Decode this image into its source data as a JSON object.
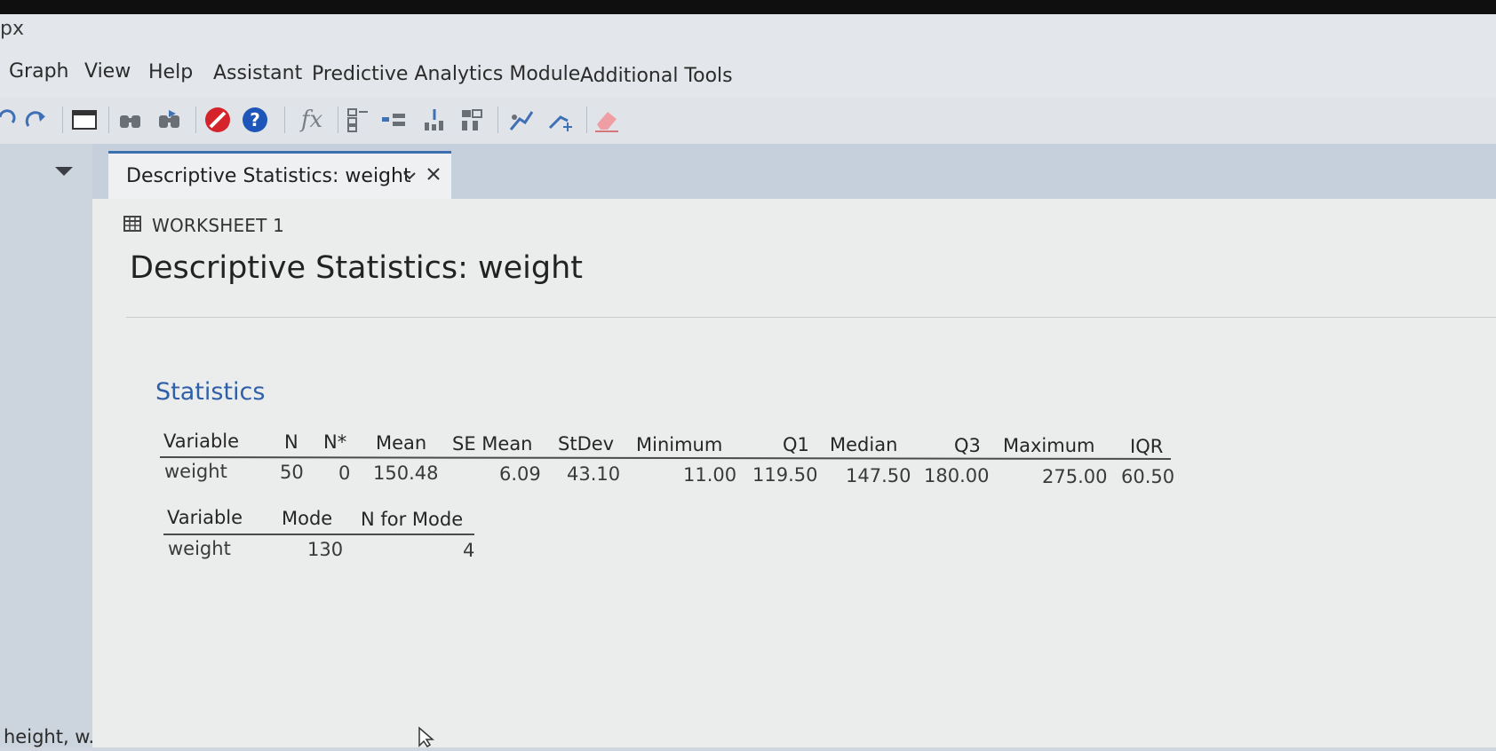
{
  "app": {
    "title_fragment": "px"
  },
  "menu": [
    "Graph",
    "View",
    "Help",
    "Assistant",
    "Predictive Analytics Module",
    "Additional Tools"
  ],
  "toolbar": {
    "icons": [
      "undo-icon",
      "redo-icon",
      "window-icon",
      "find-icon",
      "find-next-icon",
      "cancel-icon",
      "help-icon",
      "function-icon",
      "row-icon",
      "column-icon",
      "sort-icon",
      "tally-icon",
      "brush-icon",
      "crosshair-icon",
      "eraser-icon"
    ],
    "function_label": "fx"
  },
  "tab": {
    "label": "Descriptive Statistics: weight"
  },
  "output": {
    "worksheet_label": "WORKSHEET 1",
    "title": "Descriptive Statistics: weight",
    "section_title": "Statistics",
    "stats_table": {
      "headers": [
        "Variable",
        "N",
        "N*",
        "Mean",
        "SE Mean",
        "StDev",
        "Minimum",
        "Q1",
        "Median",
        "Q3",
        "Maximum",
        "IQR"
      ],
      "row": [
        "weight",
        "50",
        "0",
        "150.48",
        "6.09",
        "43.10",
        "11.00",
        "119.50",
        "147.50",
        "180.00",
        "275.00",
        "60.50"
      ]
    },
    "mode_table": {
      "headers": [
        "Variable",
        "Mode",
        "N for Mode"
      ],
      "row": [
        "weight",
        "130",
        "4"
      ]
    }
  },
  "status": {
    "text": "height, w..."
  }
}
